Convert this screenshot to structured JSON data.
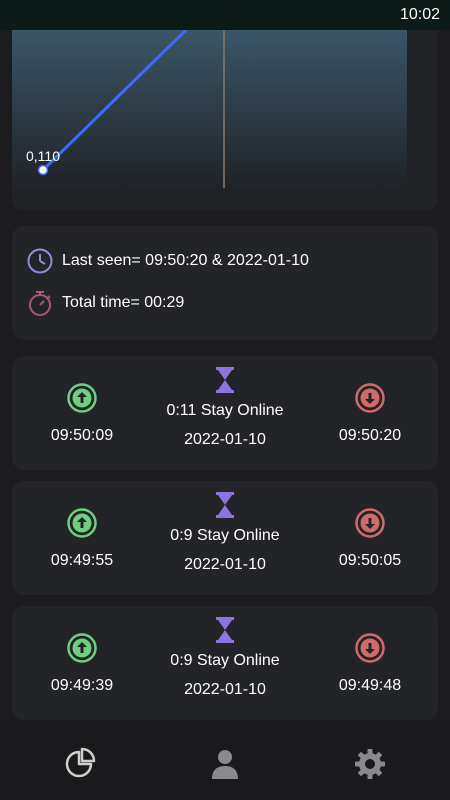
{
  "status_bar": {
    "time": "10:02"
  },
  "chart_data": {
    "type": "line",
    "point_label": "0,110"
  },
  "info": {
    "last_seen": "Last seen= 09:50:20 & 2022-01-10",
    "total_time": "Total time= 00:29"
  },
  "sessions": [
    {
      "online": "09:50:09",
      "duration": "0:11 Stay Online",
      "date": "2022-01-10",
      "offline": "09:50:20"
    },
    {
      "online": "09:49:55",
      "duration": "0:9 Stay Online",
      "date": "2022-01-10",
      "offline": "09:50:05"
    },
    {
      "online": "09:49:39",
      "duration": "0:9 Stay Online",
      "date": "2022-01-10",
      "offline": "09:49:48"
    }
  ],
  "colors": {
    "online": "#6fcf7f",
    "offline": "#d06b6b",
    "hourglass": "#8f74e0",
    "line": "#3d6df0"
  },
  "nav": {
    "items": [
      "chart-icon",
      "profile-icon",
      "settings-icon"
    ]
  }
}
